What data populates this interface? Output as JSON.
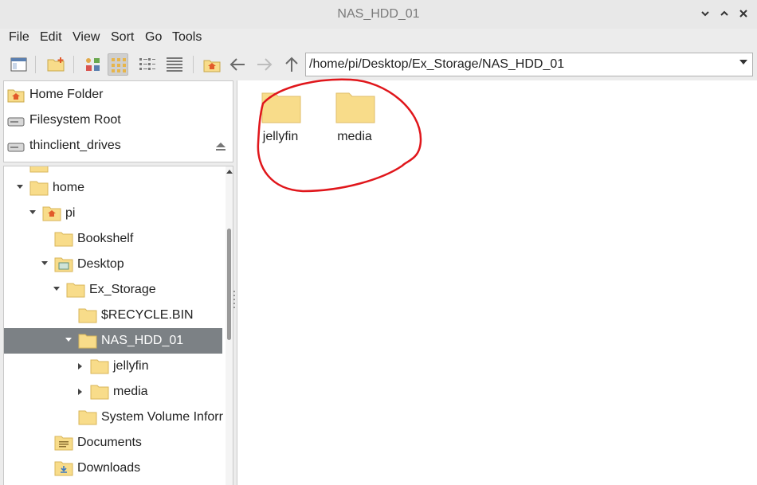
{
  "window": {
    "title": "NAS_HDD_01",
    "controls": [
      "chevron-down-icon",
      "chevron-up-icon",
      "close-icon"
    ]
  },
  "menubar": {
    "items": [
      {
        "label": "File"
      },
      {
        "label": "Edit"
      },
      {
        "label": "View"
      },
      {
        "label": "Sort"
      },
      {
        "label": "Go"
      },
      {
        "label": "Tools"
      }
    ]
  },
  "toolbar": {
    "buttons": [
      "new-window-icon",
      "new-folder-icon",
      "view-icons-icon",
      "view-thumbnails-icon",
      "view-compact-icon",
      "view-list-icon",
      "home-icon",
      "back-arrow-icon",
      "forward-arrow-icon",
      "up-arrow-icon"
    ],
    "active_view": "view-thumbnails-icon",
    "path": "/home/pi/Desktop/Ex_Storage/NAS_HDD_01"
  },
  "places": [
    {
      "label": "Home Folder",
      "icon": "home-folder-icon"
    },
    {
      "label": "Filesystem Root",
      "icon": "drive-icon"
    },
    {
      "label": "thinclient_drives",
      "icon": "drive-icon",
      "eject": true
    }
  ],
  "tree": [
    {
      "label": "home",
      "expanded": true
    },
    {
      "label": "pi",
      "expanded": true
    },
    {
      "label": "Bookshelf"
    },
    {
      "label": "Desktop",
      "expanded": true
    },
    {
      "label": "Ex_Storage",
      "expanded": true
    },
    {
      "label": "$RECYCLE.BIN"
    },
    {
      "label": "NAS_HDD_01",
      "expanded": true,
      "selected": true
    },
    {
      "label": "jellyfin",
      "expanded": false
    },
    {
      "label": "media",
      "expanded": false
    },
    {
      "label": "System Volume Inforr"
    },
    {
      "label": "Documents"
    },
    {
      "label": "Downloads"
    }
  ],
  "content": {
    "items": [
      {
        "label": "jellyfin",
        "icon": "folder-icon"
      },
      {
        "label": "media",
        "icon": "folder-icon"
      }
    ]
  },
  "colors": {
    "folder": "#f8dc8a",
    "selection": "#7c8185",
    "annotation": "#e0161b",
    "accent_home": "#e25a2a"
  }
}
